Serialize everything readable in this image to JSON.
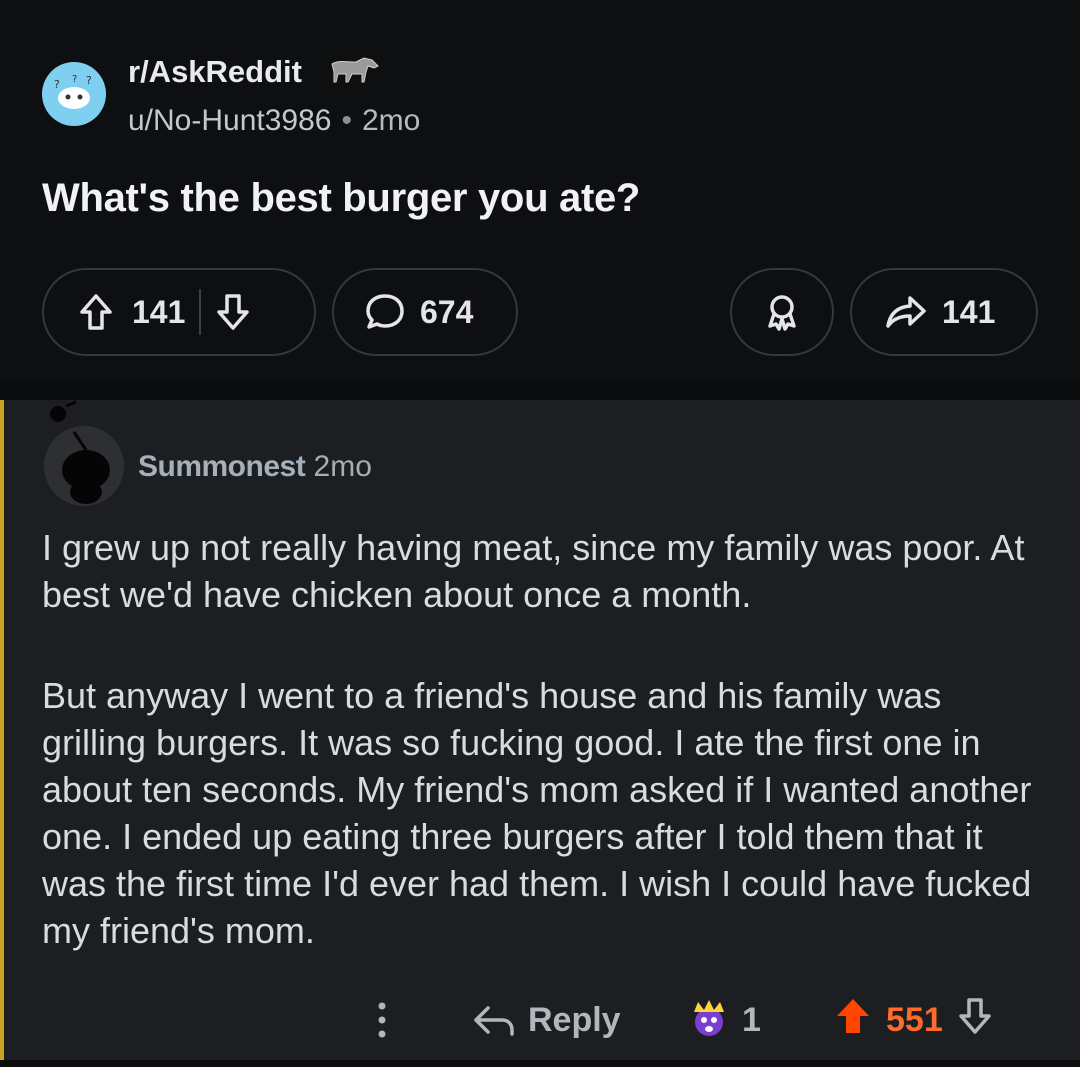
{
  "post": {
    "subreddit": "r/AskReddit",
    "author": "u/No-Hunt3986",
    "age": "2mo",
    "title": "What's the best burger you ate?",
    "upvotes": "141",
    "comments": "674",
    "shares": "141"
  },
  "comment": {
    "author": "Summonest",
    "age": "2mo",
    "paragraphs": [
      "I grew up not really having meat, since my family was poor. At best we'd have chicken about once a month.",
      "But anyway I went to a friend's house and his family was grilling burgers. It was so fucking good. I ate the first one in about ten seconds. My friend's mom asked if I wanted another one. I ended up eating three burgers after I told them that it was the first time I'd ever had them. I wish I could have fucked my friend's mom."
    ],
    "reply_label": "Reply",
    "award_count": "1",
    "score": "551"
  },
  "colors": {
    "upvote_active": "#ff4500",
    "score_active": "#ff6b2b",
    "thread_line": "#c9a227"
  }
}
